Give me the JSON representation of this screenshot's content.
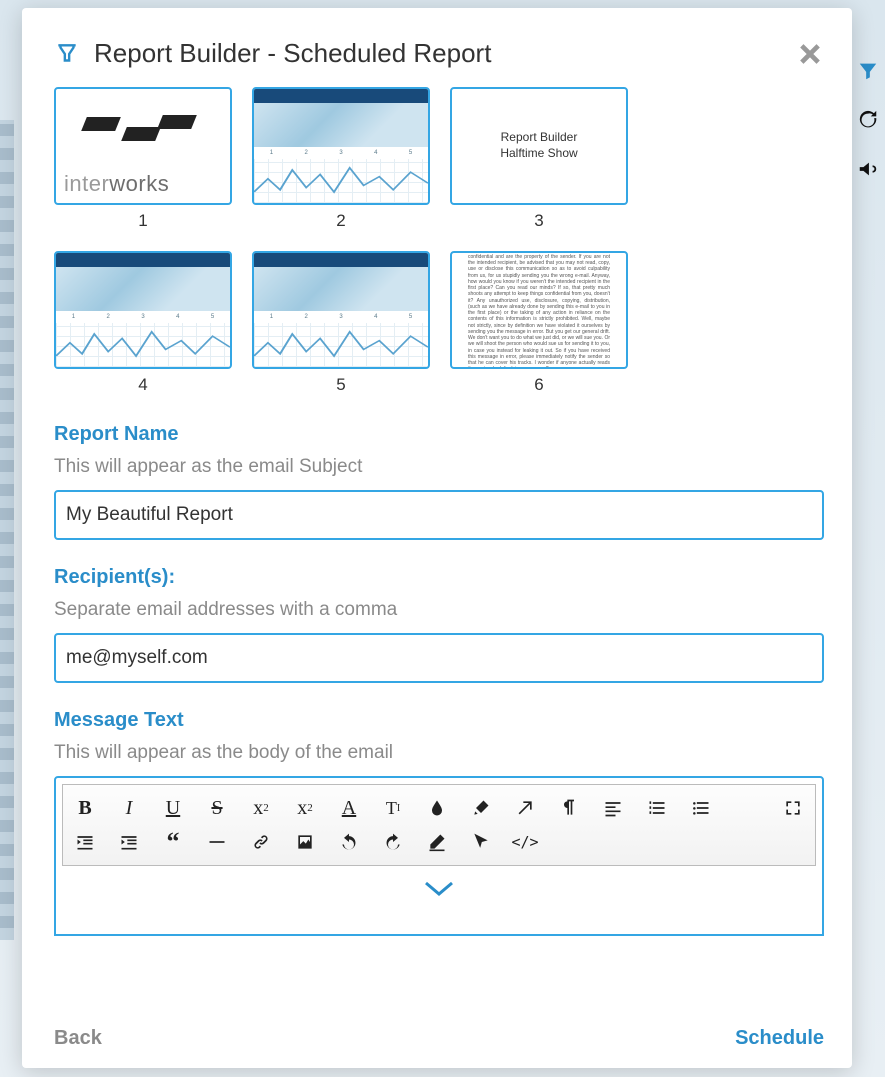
{
  "dialog_title": "Report Builder - Scheduled Report",
  "thumbnails": [
    {
      "num": "1",
      "kind": "logo",
      "logo_text_a": "inter",
      "logo_text_b": "works"
    },
    {
      "num": "2",
      "kind": "map_chart",
      "bar": ""
    },
    {
      "num": "3",
      "kind": "text",
      "line1": "Report Builder",
      "line2": "Halftime Show"
    },
    {
      "num": "4",
      "kind": "map_chart",
      "bar": ""
    },
    {
      "num": "5",
      "kind": "map_chart",
      "bar": ""
    },
    {
      "num": "6",
      "kind": "smalltext",
      "body": "The materials contained in this e-mail are private and confidential and are the property of the sender. If you are not the intended recipient, be advised that you may not read, copy, use or disclose this communication so as to avoid culpability from us, for us stupidly sending you the wrong e-mail. Anyway, how would you know if you weren't the intended recipient in the first place? Can you read our minds? If so, that pretty much shoots any attempt to keep things confidential from you, doesn't it? Any unauthorized use, disclosure, copying, distribution, (such as we have already done by sending this e-mail to you in the first place) or the taking of any action in reliance on the contents of this information is strictly prohibited. Well, maybe not strictly, since by definition we have violated it ourselves by sending you the message in error. But you get our general drift. We don't want you to do what we just did, or we will sue you. Or we will shoot the person who would sue us for sending it to you, in case you instead for leaking it out. So if you have received this message in error, please immediately notify the sender so that he can cover his tracks. I wonder if anyone actually reads these standard disclaimers anyway?"
    }
  ],
  "sections": {
    "report_name": {
      "label": "Report Name",
      "hint": "This will appear as the email Subject",
      "value": "My Beautiful Report"
    },
    "recipients": {
      "label": "Recipient(s):",
      "hint": "Separate email addresses with a comma",
      "value": "me@myself.com"
    },
    "message": {
      "label": "Message Text",
      "hint": "This will appear as the body of the email"
    }
  },
  "footer": {
    "back": "Back",
    "schedule": "Schedule"
  },
  "toolbar": {
    "bold": "B",
    "italic": "I",
    "underline": "U",
    "strike": "S",
    "sub": "x",
    "sub_sup": "2",
    "sup": "x",
    "sup_sup": "2",
    "font": "A",
    "size": "T",
    "code": "</>"
  }
}
